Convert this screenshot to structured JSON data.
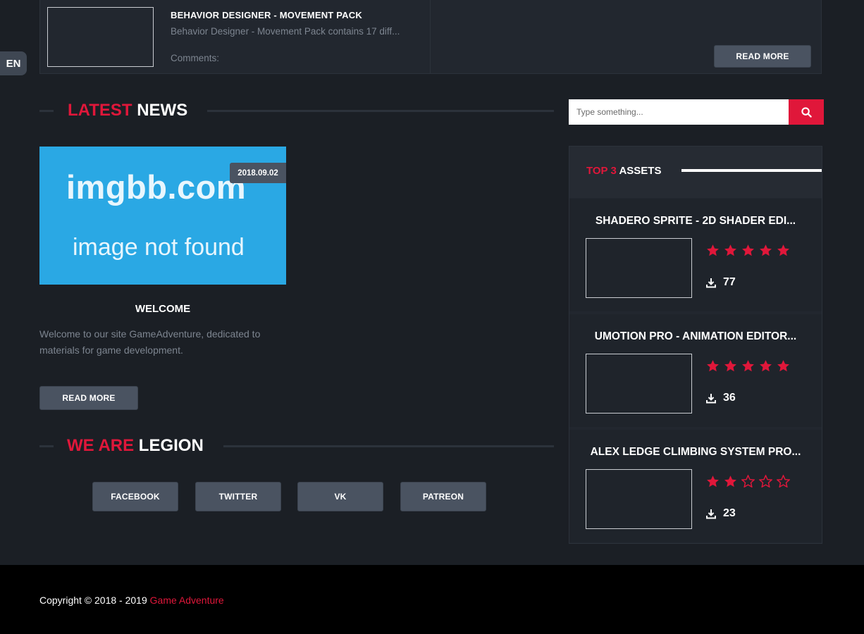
{
  "language": "EN",
  "featured": {
    "title": "BEHAVIOR DESIGNER - MOVEMENT PACK",
    "description": "Behavior Designer - Movement Pack contains 17 diff...",
    "comments_label": "Comments:",
    "read_more": "READ MORE"
  },
  "latest_news": {
    "heading_accent": "LATEST",
    "heading_rest": "NEWS",
    "image_text_line1": "imgbb.com",
    "image_text_line2": "image not found",
    "date": "2018.09.02",
    "title": "WELCOME",
    "body": "Welcome to our site GameAdventure, dedicated to materials for game development.",
    "read_more": "READ MORE"
  },
  "legion": {
    "heading_accent": "WE ARE",
    "heading_rest": "LEGION",
    "links": [
      "FACEBOOK",
      "TWITTER",
      "VK",
      "PATREON"
    ]
  },
  "search": {
    "placeholder": "Type something..."
  },
  "top_assets": {
    "heading_accent": "TOP 3",
    "heading_rest": "ASSETS",
    "items": [
      {
        "name": "SHADERO SPRITE - 2D SHADER EDI...",
        "rating": 5,
        "downloads": "77"
      },
      {
        "name": "UMOTION PRO - ANIMATION EDITOR...",
        "rating": 5,
        "downloads": "36"
      },
      {
        "name": "ALEX LEDGE CLIMBING SYSTEM PRO...",
        "rating": 2,
        "downloads": "23"
      }
    ]
  },
  "footer": {
    "copyright": "Copyright © 2018 - 2019 ",
    "brand": "Game Adventure"
  },
  "colors": {
    "accent": "#e0173a",
    "button": "#4a5361",
    "background": "#1b1f25"
  },
  "icons": {
    "search": "search-icon",
    "download": "download-icon",
    "star": "star-icon"
  }
}
